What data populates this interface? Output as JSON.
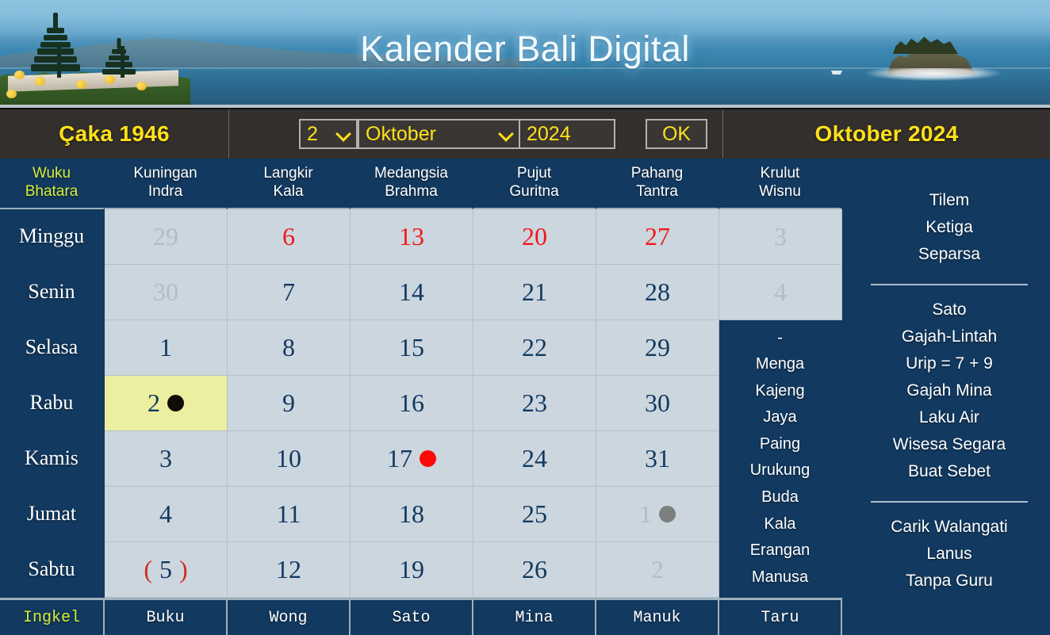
{
  "banner": {
    "title": "Kalender Bali Digital",
    "left_image": "bali-temple-lake-photo",
    "right_image": "rock-island-sea-photo"
  },
  "controls": {
    "saka_label": "Çaka 1946",
    "day_value": "2",
    "month_value": "Oktober",
    "year_value": "2024",
    "ok_label": "OK",
    "month_title": "Oktober 2024"
  },
  "grid": {
    "headers": [
      {
        "line1": "Wuku",
        "line2": "Bhatara"
      },
      {
        "line1": "Kuningan",
        "line2": "Indra"
      },
      {
        "line1": "Langkir",
        "line2": "Kala"
      },
      {
        "line1": "Medangsia",
        "line2": "Brahma"
      },
      {
        "line1": "Pujut",
        "line2": "Guritna"
      },
      {
        "line1": "Pahang",
        "line2": "Tantra"
      },
      {
        "line1": "Krulut",
        "line2": "Wisnu"
      }
    ],
    "days": [
      "Minggu",
      "Senin",
      "Selasa",
      "Rabu",
      "Kamis",
      "Jumat",
      "Sabtu"
    ],
    "rows": [
      [
        {
          "text": "29",
          "style": "off"
        },
        {
          "text": "6",
          "style": "sun"
        },
        {
          "text": "13",
          "style": "sun"
        },
        {
          "text": "20",
          "style": "sun"
        },
        {
          "text": "27",
          "style": "sun"
        },
        {
          "text": "3",
          "style": "off"
        }
      ],
      [
        {
          "text": "30",
          "style": "off"
        },
        {
          "text": "7",
          "style": ""
        },
        {
          "text": "14",
          "style": ""
        },
        {
          "text": "21",
          "style": ""
        },
        {
          "text": "28",
          "style": ""
        },
        {
          "text": "4",
          "style": "off"
        }
      ],
      [
        {
          "text": "1",
          "style": ""
        },
        {
          "text": "8",
          "style": ""
        },
        {
          "text": "15",
          "style": ""
        },
        {
          "text": "22",
          "style": ""
        },
        {
          "text": "29",
          "style": ""
        }
      ],
      [
        {
          "text": "2",
          "style": "today",
          "moon": "black"
        },
        {
          "text": "9",
          "style": ""
        },
        {
          "text": "16",
          "style": ""
        },
        {
          "text": "23",
          "style": ""
        },
        {
          "text": "30",
          "style": ""
        }
      ],
      [
        {
          "text": "3",
          "style": ""
        },
        {
          "text": "10",
          "style": ""
        },
        {
          "text": "17",
          "style": "",
          "moon": "red"
        },
        {
          "text": "24",
          "style": ""
        },
        {
          "text": "31",
          "style": ""
        }
      ],
      [
        {
          "text": "4",
          "style": ""
        },
        {
          "text": "11",
          "style": ""
        },
        {
          "text": "18",
          "style": ""
        },
        {
          "text": "25",
          "style": ""
        },
        {
          "text": "1",
          "style": "off",
          "moon": "gray"
        }
      ],
      [
        {
          "text": "(5)",
          "style": "paren"
        },
        {
          "text": "12",
          "style": ""
        },
        {
          "text": "19",
          "style": ""
        },
        {
          "text": "26",
          "style": ""
        },
        {
          "text": "2",
          "style": "off"
        }
      ]
    ],
    "krulut_info": [
      "-",
      "Menga",
      "Kajeng",
      "Jaya",
      "Paing",
      "Urukung",
      "Buda",
      "Kala",
      "Erangan",
      "Manusa"
    ],
    "footer": [
      "Ingkel",
      "Buku",
      "Wong",
      "Sato",
      "Mina",
      "Manuk",
      "Taru"
    ]
  },
  "sidepanel": {
    "group1": [
      "Tilem",
      "Ketiga",
      "Separsa"
    ],
    "group2": [
      "Sato",
      "Gajah-Lintah",
      "Urip = 7 + 9",
      "Gajah Mina",
      "Laku Air",
      "Wisesa Segara",
      "Buat Sebet"
    ],
    "group3": [
      "Carik Walangati",
      "Lanus",
      "Tanpa Guru"
    ]
  },
  "colors": {
    "panel_blue": "#12395f",
    "cell_bg": "#ccd6df",
    "accent_yellow": "#ffe11a",
    "sunday_red": "#ef1a1a",
    "today_bg": "#ecefa0",
    "wuku_green": "#d7ef3a"
  }
}
